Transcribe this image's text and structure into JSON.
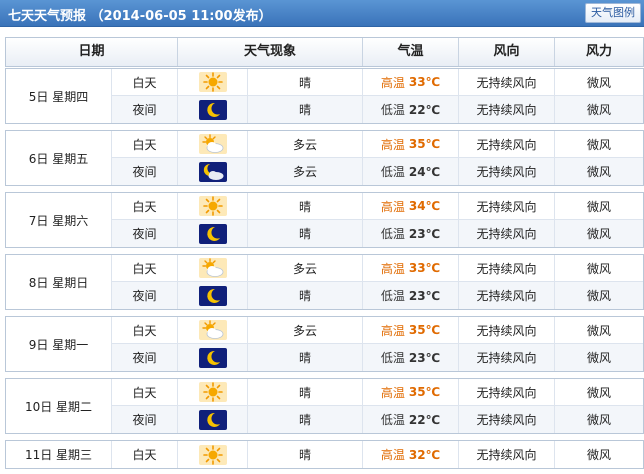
{
  "title": "七天天气预报 （2014-06-05 11:00发布）",
  "map_button": "天气图例",
  "columns": [
    "日期",
    "天气现象",
    "气温",
    "风向",
    "风力"
  ],
  "days": [
    {
      "date": "5日 星期四",
      "rows": [
        {
          "period": "白天",
          "icon": "sun-icon",
          "phen": "晴",
          "temp_label": "高温",
          "temp": "33℃",
          "wind_dir": "无持续风向",
          "wind_pow": "微风"
        },
        {
          "period": "夜间",
          "icon": "moon-icon",
          "phen": "晴",
          "temp_label": "低温",
          "temp": "22℃",
          "wind_dir": "无持续风向",
          "wind_pow": "微风"
        }
      ]
    },
    {
      "date": "6日 星期五",
      "rows": [
        {
          "period": "白天",
          "icon": "sun-cloud-icon",
          "phen": "多云",
          "temp_label": "高温",
          "temp": "35℃",
          "wind_dir": "无持续风向",
          "wind_pow": "微风"
        },
        {
          "period": "夜间",
          "icon": "moon-cloud-icon",
          "phen": "多云",
          "temp_label": "低温",
          "temp": "24℃",
          "wind_dir": "无持续风向",
          "wind_pow": "微风"
        }
      ]
    },
    {
      "date": "7日 星期六",
      "rows": [
        {
          "period": "白天",
          "icon": "sun-icon",
          "phen": "晴",
          "temp_label": "高温",
          "temp": "34℃",
          "wind_dir": "无持续风向",
          "wind_pow": "微风"
        },
        {
          "period": "夜间",
          "icon": "moon-icon",
          "phen": "晴",
          "temp_label": "低温",
          "temp": "23℃",
          "wind_dir": "无持续风向",
          "wind_pow": "微风"
        }
      ]
    },
    {
      "date": "8日 星期日",
      "rows": [
        {
          "period": "白天",
          "icon": "sun-cloud-icon",
          "phen": "多云",
          "temp_label": "高温",
          "temp": "33℃",
          "wind_dir": "无持续风向",
          "wind_pow": "微风"
        },
        {
          "period": "夜间",
          "icon": "moon-icon",
          "phen": "晴",
          "temp_label": "低温",
          "temp": "23℃",
          "wind_dir": "无持续风向",
          "wind_pow": "微风"
        }
      ]
    },
    {
      "date": "9日 星期一",
      "rows": [
        {
          "period": "白天",
          "icon": "sun-cloud-icon",
          "phen": "多云",
          "temp_label": "高温",
          "temp": "35℃",
          "wind_dir": "无持续风向",
          "wind_pow": "微风"
        },
        {
          "period": "夜间",
          "icon": "moon-icon",
          "phen": "晴",
          "temp_label": "低温",
          "temp": "23℃",
          "wind_dir": "无持续风向",
          "wind_pow": "微风"
        }
      ]
    },
    {
      "date": "10日 星期二",
      "rows": [
        {
          "period": "白天",
          "icon": "sun-icon",
          "phen": "晴",
          "temp_label": "高温",
          "temp": "35℃",
          "wind_dir": "无持续风向",
          "wind_pow": "微风"
        },
        {
          "period": "夜间",
          "icon": "moon-icon",
          "phen": "晴",
          "temp_label": "低温",
          "temp": "22℃",
          "wind_dir": "无持续风向",
          "wind_pow": "微风"
        }
      ]
    },
    {
      "date": "11日 星期三",
      "rows": [
        {
          "period": "白天",
          "icon": "sun-icon",
          "phen": "晴",
          "temp_label": "高温",
          "temp": "32℃",
          "wind_dir": "无持续风向",
          "wind_pow": "微风"
        }
      ]
    }
  ],
  "colors": {
    "title_bar": "#3a73b9",
    "high_temp": "#e06a00",
    "night_icon_bg": "#10207a",
    "day_icon_bg": "#fde9b8"
  }
}
